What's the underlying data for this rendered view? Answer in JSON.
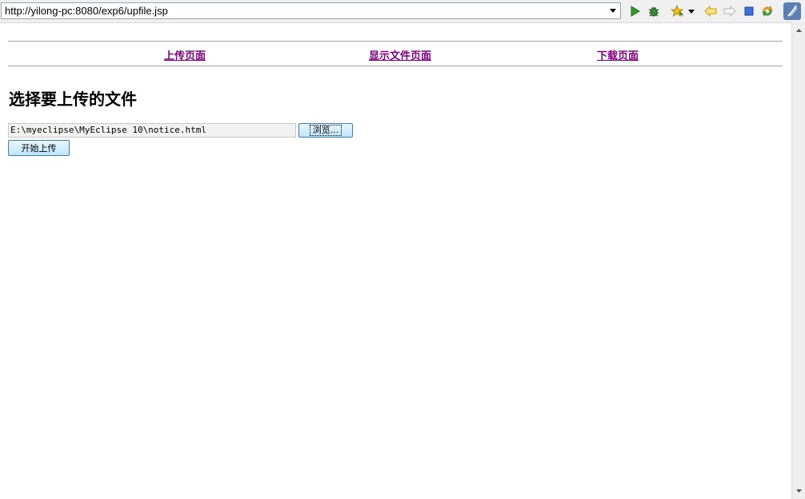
{
  "address_bar": {
    "url": "http://yilong-pc:8080/exp6/upfile.jsp"
  },
  "toolbar": {
    "icons": [
      "run-icon",
      "debug-icon",
      "bookmark-star-icon",
      "dropdown-icon",
      "back-icon",
      "forward-icon",
      "stop-icon",
      "refresh-icon",
      "eclipse-icon"
    ]
  },
  "nav": {
    "items": [
      {
        "label": "上传页面"
      },
      {
        "label": "显示文件页面"
      },
      {
        "label": "下载页面"
      }
    ],
    "link_color": "#800080"
  },
  "main": {
    "heading": "选择要上传的文件",
    "file_path": "E:\\myeclipse\\MyEclipse 10\\notice.html",
    "browse_label": "浏览...",
    "upload_label": "开始上传"
  }
}
